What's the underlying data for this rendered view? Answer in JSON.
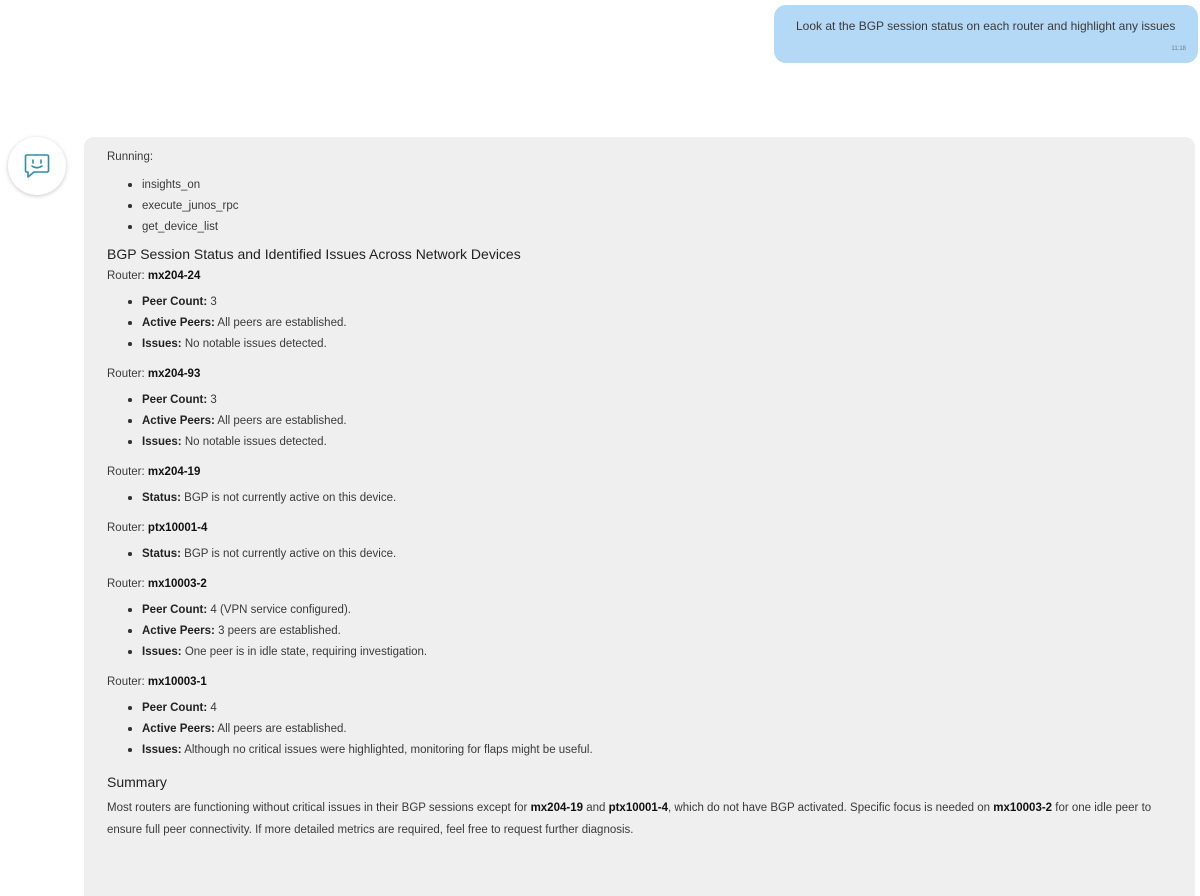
{
  "user_message": {
    "text": "Look at the BGP session status on each router and highlight any issues",
    "time": "11:18"
  },
  "assistant": {
    "running_label": "Running:",
    "tools": [
      "insights_on",
      "execute_junos_rpc",
      "get_device_list"
    ],
    "title": "BGP Session Status and Identified Issues Across Network Devices",
    "router_prefix": "Router: ",
    "routers": [
      {
        "name": "mx204-24",
        "details": [
          {
            "label": "Peer Count:",
            "value": " 3"
          },
          {
            "label": "Active Peers:",
            "value": " All peers are established."
          },
          {
            "label": "Issues:",
            "value": " No notable issues detected."
          }
        ]
      },
      {
        "name": "mx204-93",
        "details": [
          {
            "label": "Peer Count:",
            "value": " 3"
          },
          {
            "label": "Active Peers:",
            "value": " All peers are established."
          },
          {
            "label": "Issues:",
            "value": " No notable issues detected."
          }
        ]
      },
      {
        "name": "mx204-19",
        "details": [
          {
            "label": "Status:",
            "value": " BGP is not currently active on this device."
          }
        ]
      },
      {
        "name": "ptx10001-4",
        "details": [
          {
            "label": "Status:",
            "value": " BGP is not currently active on this device."
          }
        ]
      },
      {
        "name": "mx10003-2",
        "details": [
          {
            "label": "Peer Count:",
            "value": " 4 (VPN service configured)."
          },
          {
            "label": "Active Peers:",
            "value": " 3 peers are established."
          },
          {
            "label": "Issues:",
            "value": " One peer is in idle state, requiring investigation."
          }
        ]
      },
      {
        "name": "mx10003-1",
        "details": [
          {
            "label": "Peer Count:",
            "value": " 4"
          },
          {
            "label": "Active Peers:",
            "value": " All peers are established."
          },
          {
            "label": "Issues:",
            "value": " Although no critical issues were highlighted, monitoring for flaps might be useful."
          }
        ]
      }
    ],
    "summary_title": "Summary",
    "summary": {
      "t1": "Most routers are functioning without critical issues in their BGP sessions except for ",
      "b1": "mx204-19",
      "t2": " and ",
      "b2": "ptx10001-4",
      "t3": ", which do not have BGP activated. Specific focus is needed on ",
      "b3": "mx10003-2",
      "t4": " for one idle peer to ensure full peer connectivity. If more detailed metrics are required, feel free to request further diagnosis."
    }
  },
  "colors": {
    "user_bubble": "#b3d9f7",
    "assistant_bubble": "#efefef",
    "avatar_icon": "#2f8cab"
  },
  "icons": {
    "avatar": "chat-smile-icon"
  }
}
